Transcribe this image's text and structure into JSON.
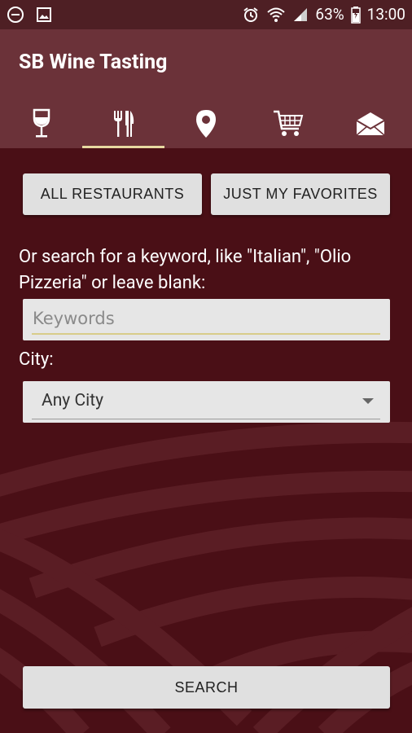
{
  "status_bar": {
    "battery": "63%",
    "time": "13:00",
    "icons": [
      "do-not-disturb-icon",
      "image-icon",
      "alarm-icon",
      "wifi-icon",
      "signal-icon",
      "battery-icon"
    ]
  },
  "app": {
    "title": "SB Wine Tasting"
  },
  "tabs": [
    {
      "icon": "wine-glass-icon",
      "active": false
    },
    {
      "icon": "fork-knife-icon",
      "active": true
    },
    {
      "icon": "map-pin-icon",
      "active": false
    },
    {
      "icon": "shopping-cart-icon",
      "active": false
    },
    {
      "icon": "mail-icon",
      "active": false
    }
  ],
  "filters": {
    "all_label": "ALL RESTAURANTS",
    "favorites_label": "JUST MY FAVORITES"
  },
  "search": {
    "prompt": "Or search for a keyword, like \"Italian\", \"Olio Pizzeria\" or leave blank:",
    "keyword_placeholder": "Keywords",
    "keyword_value": "",
    "city_label": "City:",
    "city_value": "Any City",
    "submit_label": "SEARCH"
  },
  "colors": {
    "appbar": "#6b3239",
    "background": "#4a0f16",
    "tab_indicator": "#e7d9a1",
    "button": "#e0e0e0"
  }
}
